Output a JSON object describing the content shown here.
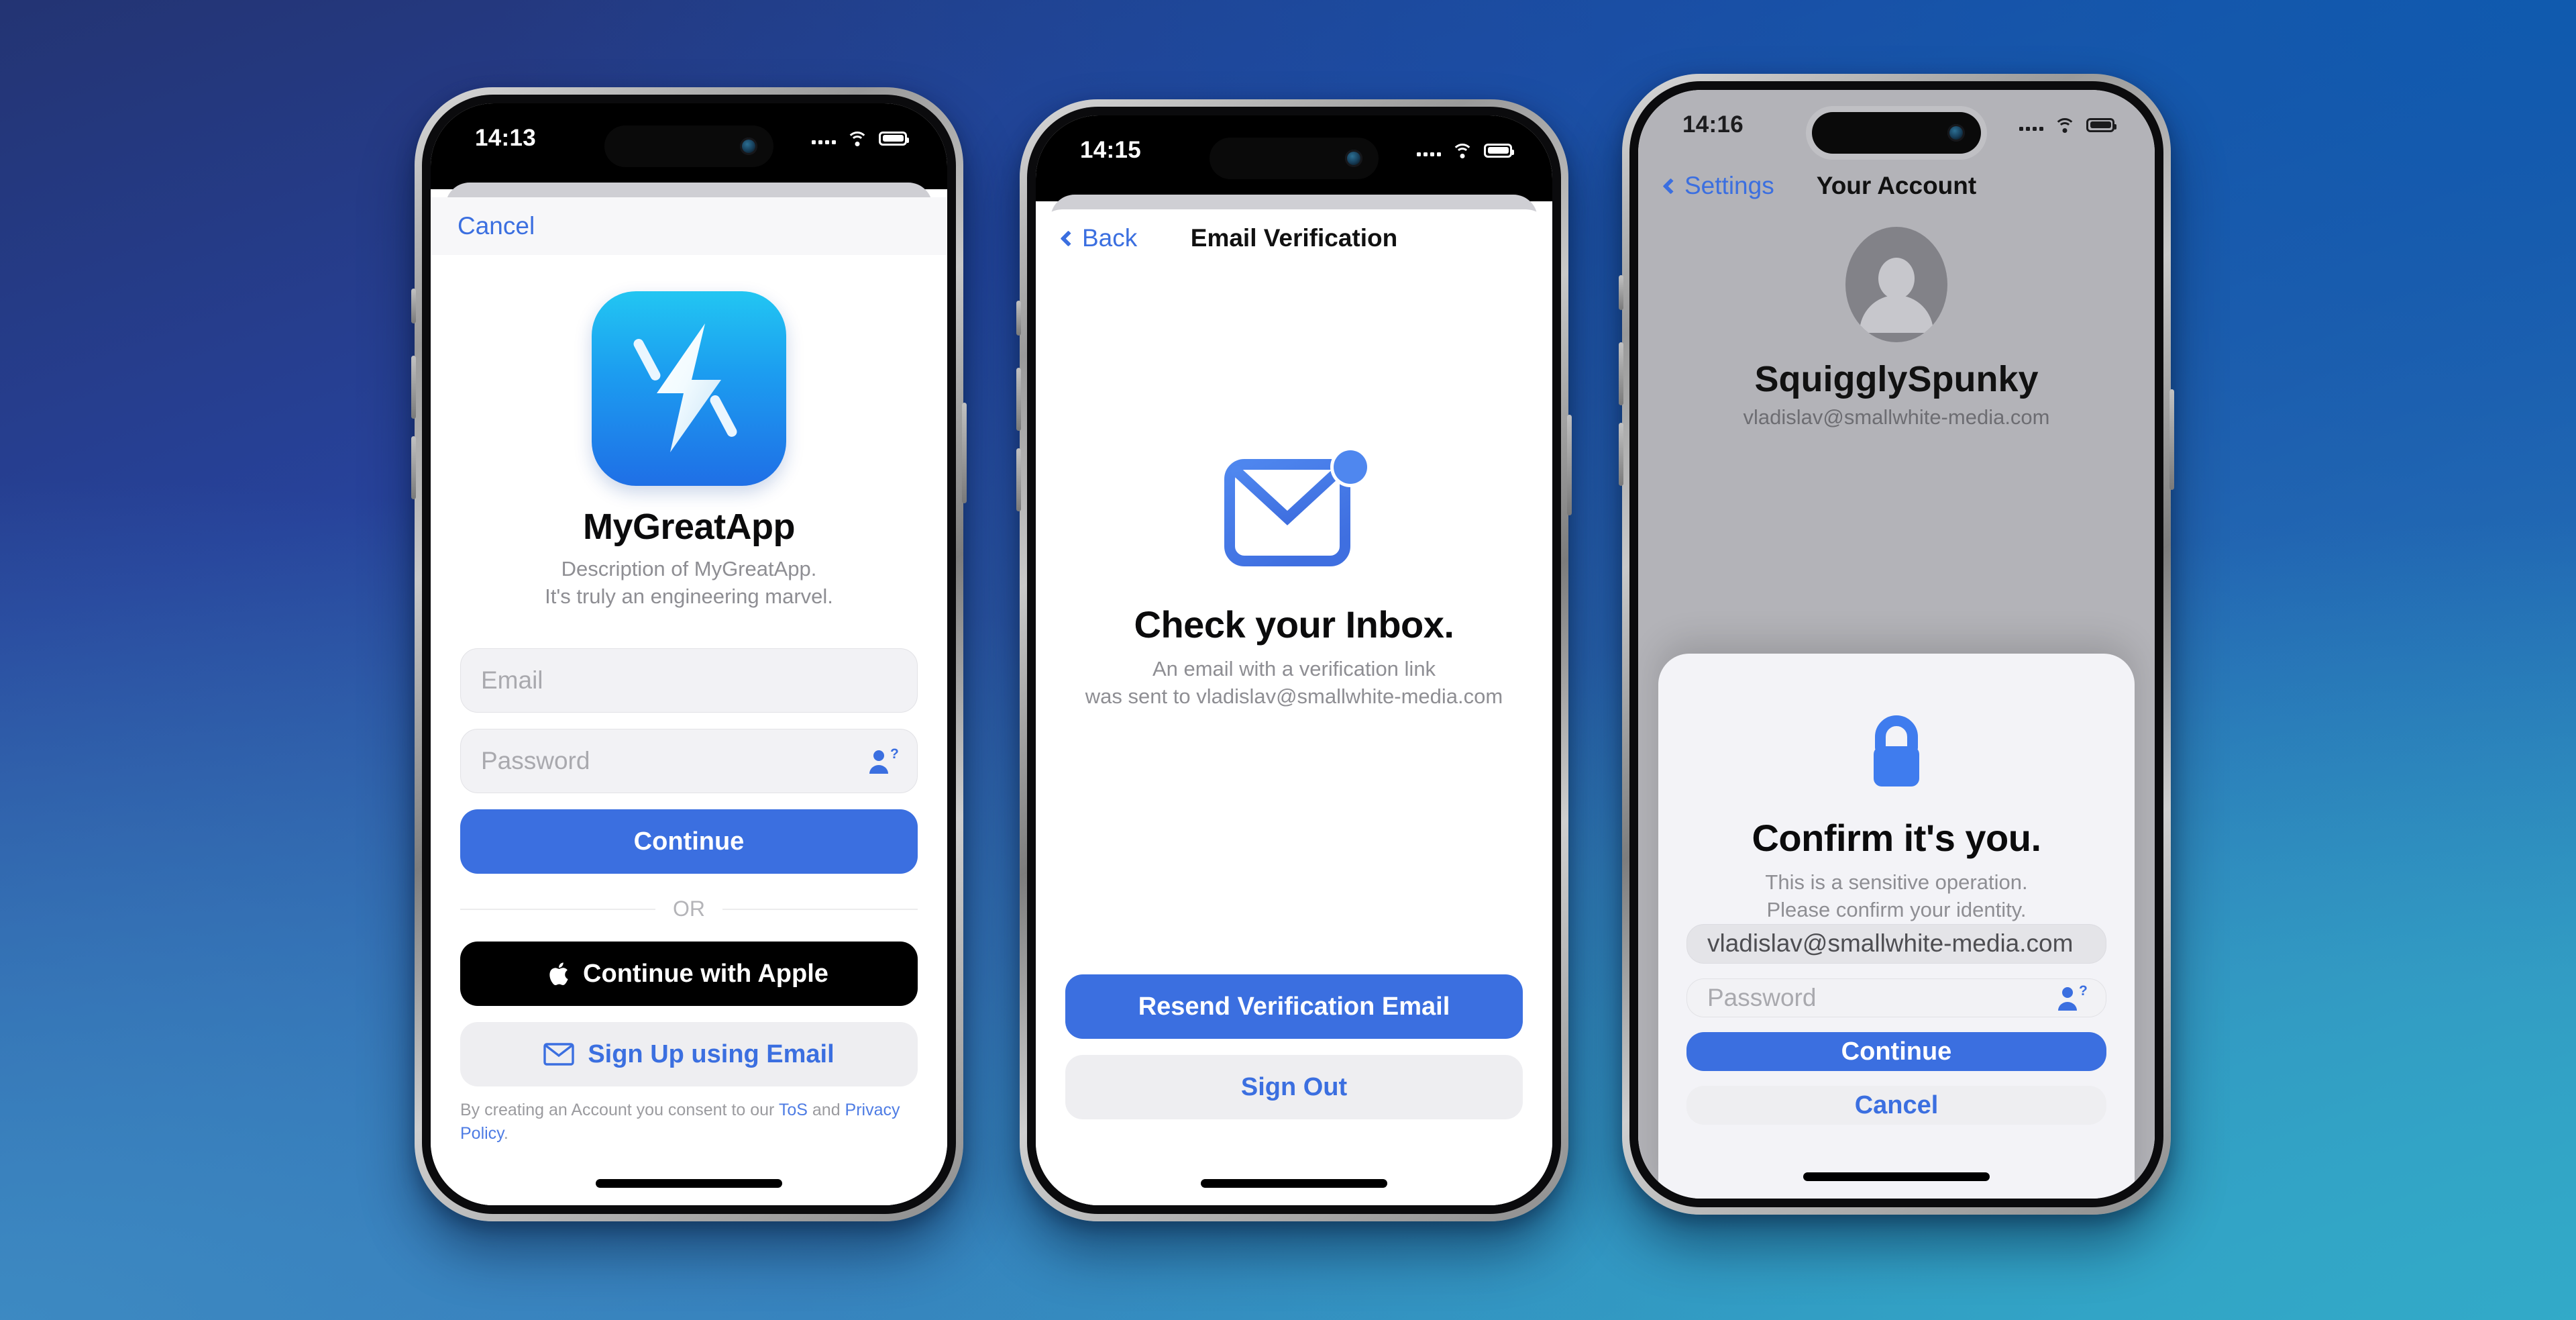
{
  "background": {
    "gradient_from": "#233473",
    "gradient_to": "#33a0c4"
  },
  "theme": {
    "accent": "#3b6fe0",
    "link": "#4e7ce4",
    "muted": "#8e8e93",
    "field_bg": "#f2f2f5"
  },
  "phones": [
    {
      "id": "signin",
      "status": {
        "time": "14:13",
        "wifi": "wifi-icon",
        "battery": "battery-icon",
        "signal": "signal-icon"
      },
      "nav": {
        "left_label": "Cancel",
        "title": ""
      },
      "app": {
        "icon": "lightning-bolt-app-icon",
        "name": "MyGreatApp",
        "description_line1": "Description of MyGreatApp.",
        "description_line2": "It's truly an engineering marvel."
      },
      "form": {
        "email_placeholder": "Email",
        "email_value": "",
        "password_placeholder": "Password",
        "password_value": "",
        "password_icon": "password-autofill-icon",
        "continue_label": "Continue"
      },
      "divider_label": "OR",
      "apple_button": {
        "icon": "apple-logo-icon",
        "label": "Continue with Apple"
      },
      "email_signup_button": {
        "icon": "envelope-icon",
        "label": "Sign Up using Email"
      },
      "legal": {
        "prefix": "By creating an Account you consent to our ",
        "tos": "ToS",
        "middle": " and ",
        "privacy": "Privacy Policy",
        "suffix": "."
      }
    },
    {
      "id": "verify",
      "status": {
        "time": "14:15",
        "wifi": "wifi-icon",
        "battery": "battery-icon",
        "signal": "signal-icon"
      },
      "nav": {
        "left_label": "Back",
        "title": "Email Verification"
      },
      "hero": {
        "icon": "envelope-badge-icon",
        "title": "Check your Inbox.",
        "sub_line1": "An email with a verification link",
        "sub_line2": "was sent to vladislav@smallwhite-media.com"
      },
      "resend_label": "Resend Verification Email",
      "signout_label": "Sign Out"
    },
    {
      "id": "account",
      "status": {
        "time": "14:16",
        "wifi": "wifi-icon",
        "battery": "battery-icon",
        "signal": "signal-icon"
      },
      "nav": {
        "left_label": "Settings",
        "title": "Your Account"
      },
      "profile": {
        "avatar": "person-avatar-icon",
        "username": "SquigglySpunky",
        "email": "vladislav@smallwhite-media.com"
      },
      "modal": {
        "icon": "lock-icon",
        "title": "Confirm it's you.",
        "sub_line1": "This is a sensitive operation.",
        "sub_line2": "Please confirm your identity.",
        "email_value": "vladislav@smallwhite-media.com",
        "password_placeholder": "Password",
        "password_icon": "password-autofill-icon",
        "continue_label": "Continue",
        "cancel_label": "Cancel"
      }
    }
  ]
}
